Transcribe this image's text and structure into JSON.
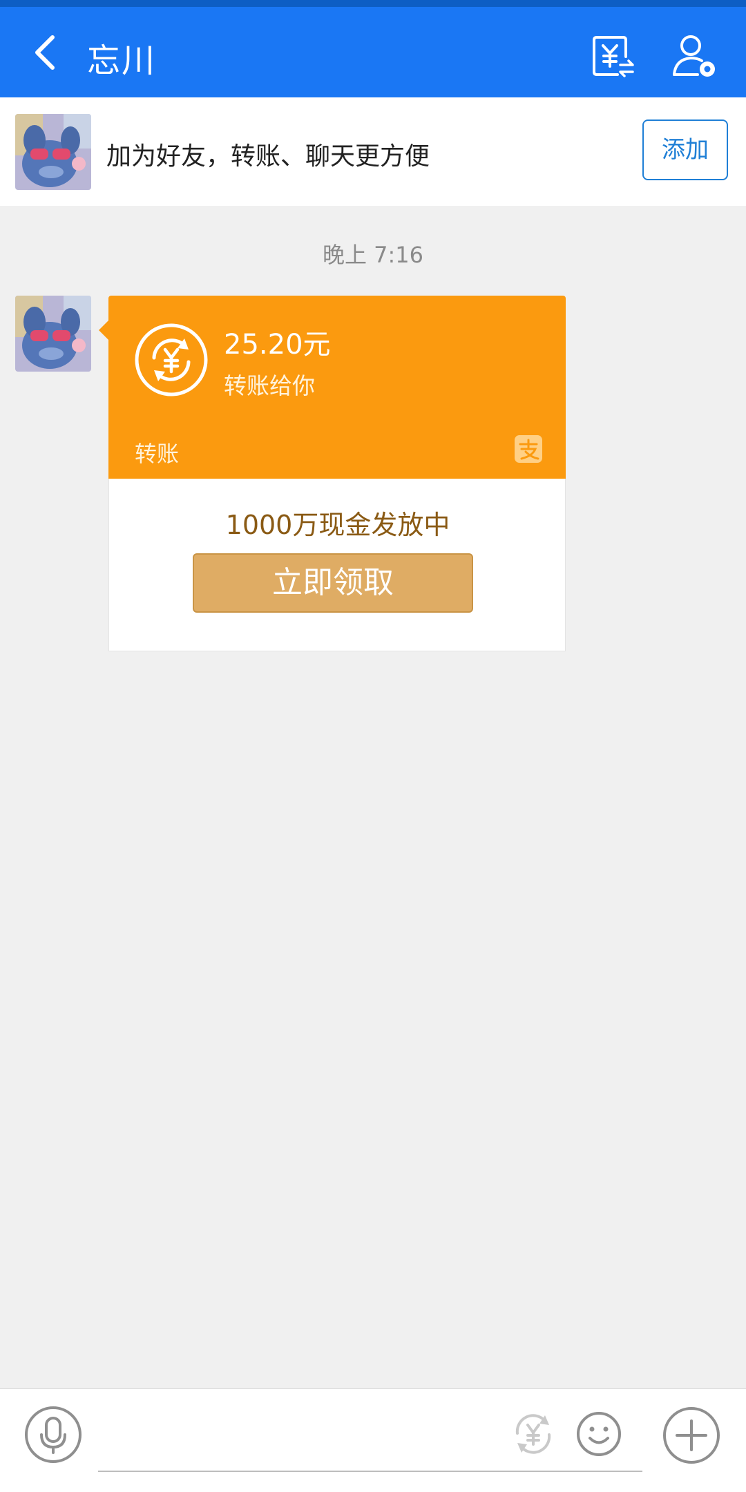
{
  "header": {
    "title": "忘川",
    "back_icon": "chevron-left-icon",
    "transfer_icon": "yuan-transfer-icon",
    "profile_icon": "user-settings-icon",
    "color": "#1a77f4"
  },
  "friend_prompt": {
    "text": "加为好友，转账、聊天更方便",
    "add_label": "添加"
  },
  "chat": {
    "timestamp": "晚上 7:16",
    "transfer_card": {
      "amount": "25.20元",
      "description": "转账给你",
      "footer_label": "转账",
      "accent_color": "#fb9a0f"
    },
    "promo": {
      "text": "1000万现金发放中",
      "button_label": "立即领取"
    }
  },
  "input_bar": {
    "message_placeholder": "",
    "icons": [
      "microphone-icon",
      "yuan-icon",
      "emoji-icon",
      "plus-icon"
    ]
  }
}
